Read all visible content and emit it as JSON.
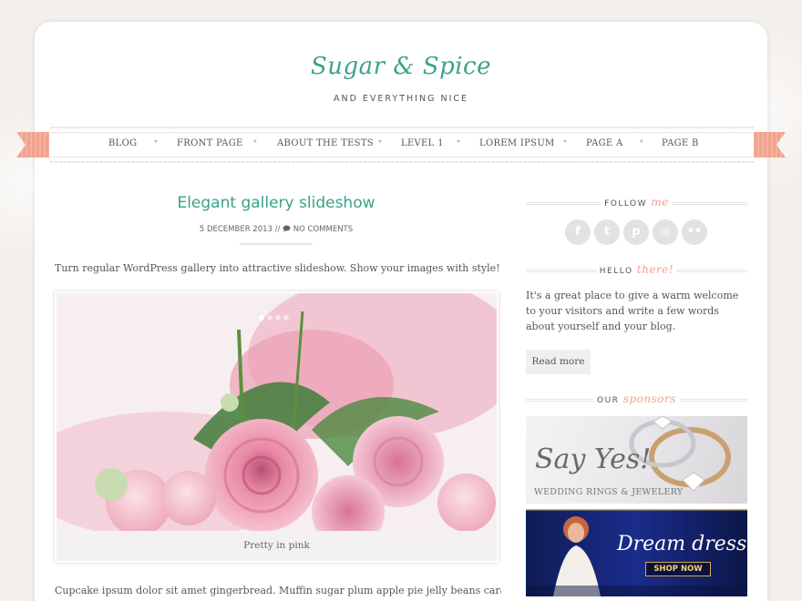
{
  "site": {
    "title": "Sugar & Spice",
    "tagline": "AND EVERYTHING NICE"
  },
  "nav": {
    "items": [
      "BLOG",
      "FRONT PAGE",
      "ABOUT THE TESTS",
      "LEVEL 1",
      "LOREM IPSUM",
      "PAGE A",
      "PAGE B"
    ],
    "separator": "•"
  },
  "post": {
    "title": "Elegant gallery slideshow",
    "date": "5 DECEMBER 2013",
    "meta_sep": "//",
    "comments": "NO COMMENTS",
    "intro": "Turn regular WordPress gallery into attractive slideshow. Show your images with style!",
    "caption": "Pretty in pink",
    "slides_total": 4,
    "slides_active": 1,
    "body": "Cupcake ipsum dolor sit amet gingerbread. Muffin sugar plum apple pie jelly beans caramels"
  },
  "sidebar": {
    "follow": {
      "label": "FOLLOW",
      "accent": "me"
    },
    "social_icons": [
      "facebook-icon",
      "twitter-icon",
      "pinterest-icon",
      "instagram-icon",
      "flickr-icon"
    ],
    "social_glyphs": [
      "f",
      "t",
      "p",
      "◎",
      "••"
    ],
    "hello": {
      "label": "HELLO",
      "accent": "there!",
      "text": "It's a great place to give a warm welcome to your visitors and write a few words about yourself and your blog.",
      "button": "Read more"
    },
    "sponsors": {
      "label": "OUR",
      "accent": "sponsors",
      "ad1": {
        "headline": "Say Yes!",
        "subline": "WEDDING RINGS & JEWELERY"
      },
      "ad2": {
        "headline": "Dream dress",
        "cta": "SHOP NOW"
      }
    }
  },
  "colors": {
    "accent_green": "#3aa38a",
    "accent_peach": "#f2a28c"
  }
}
